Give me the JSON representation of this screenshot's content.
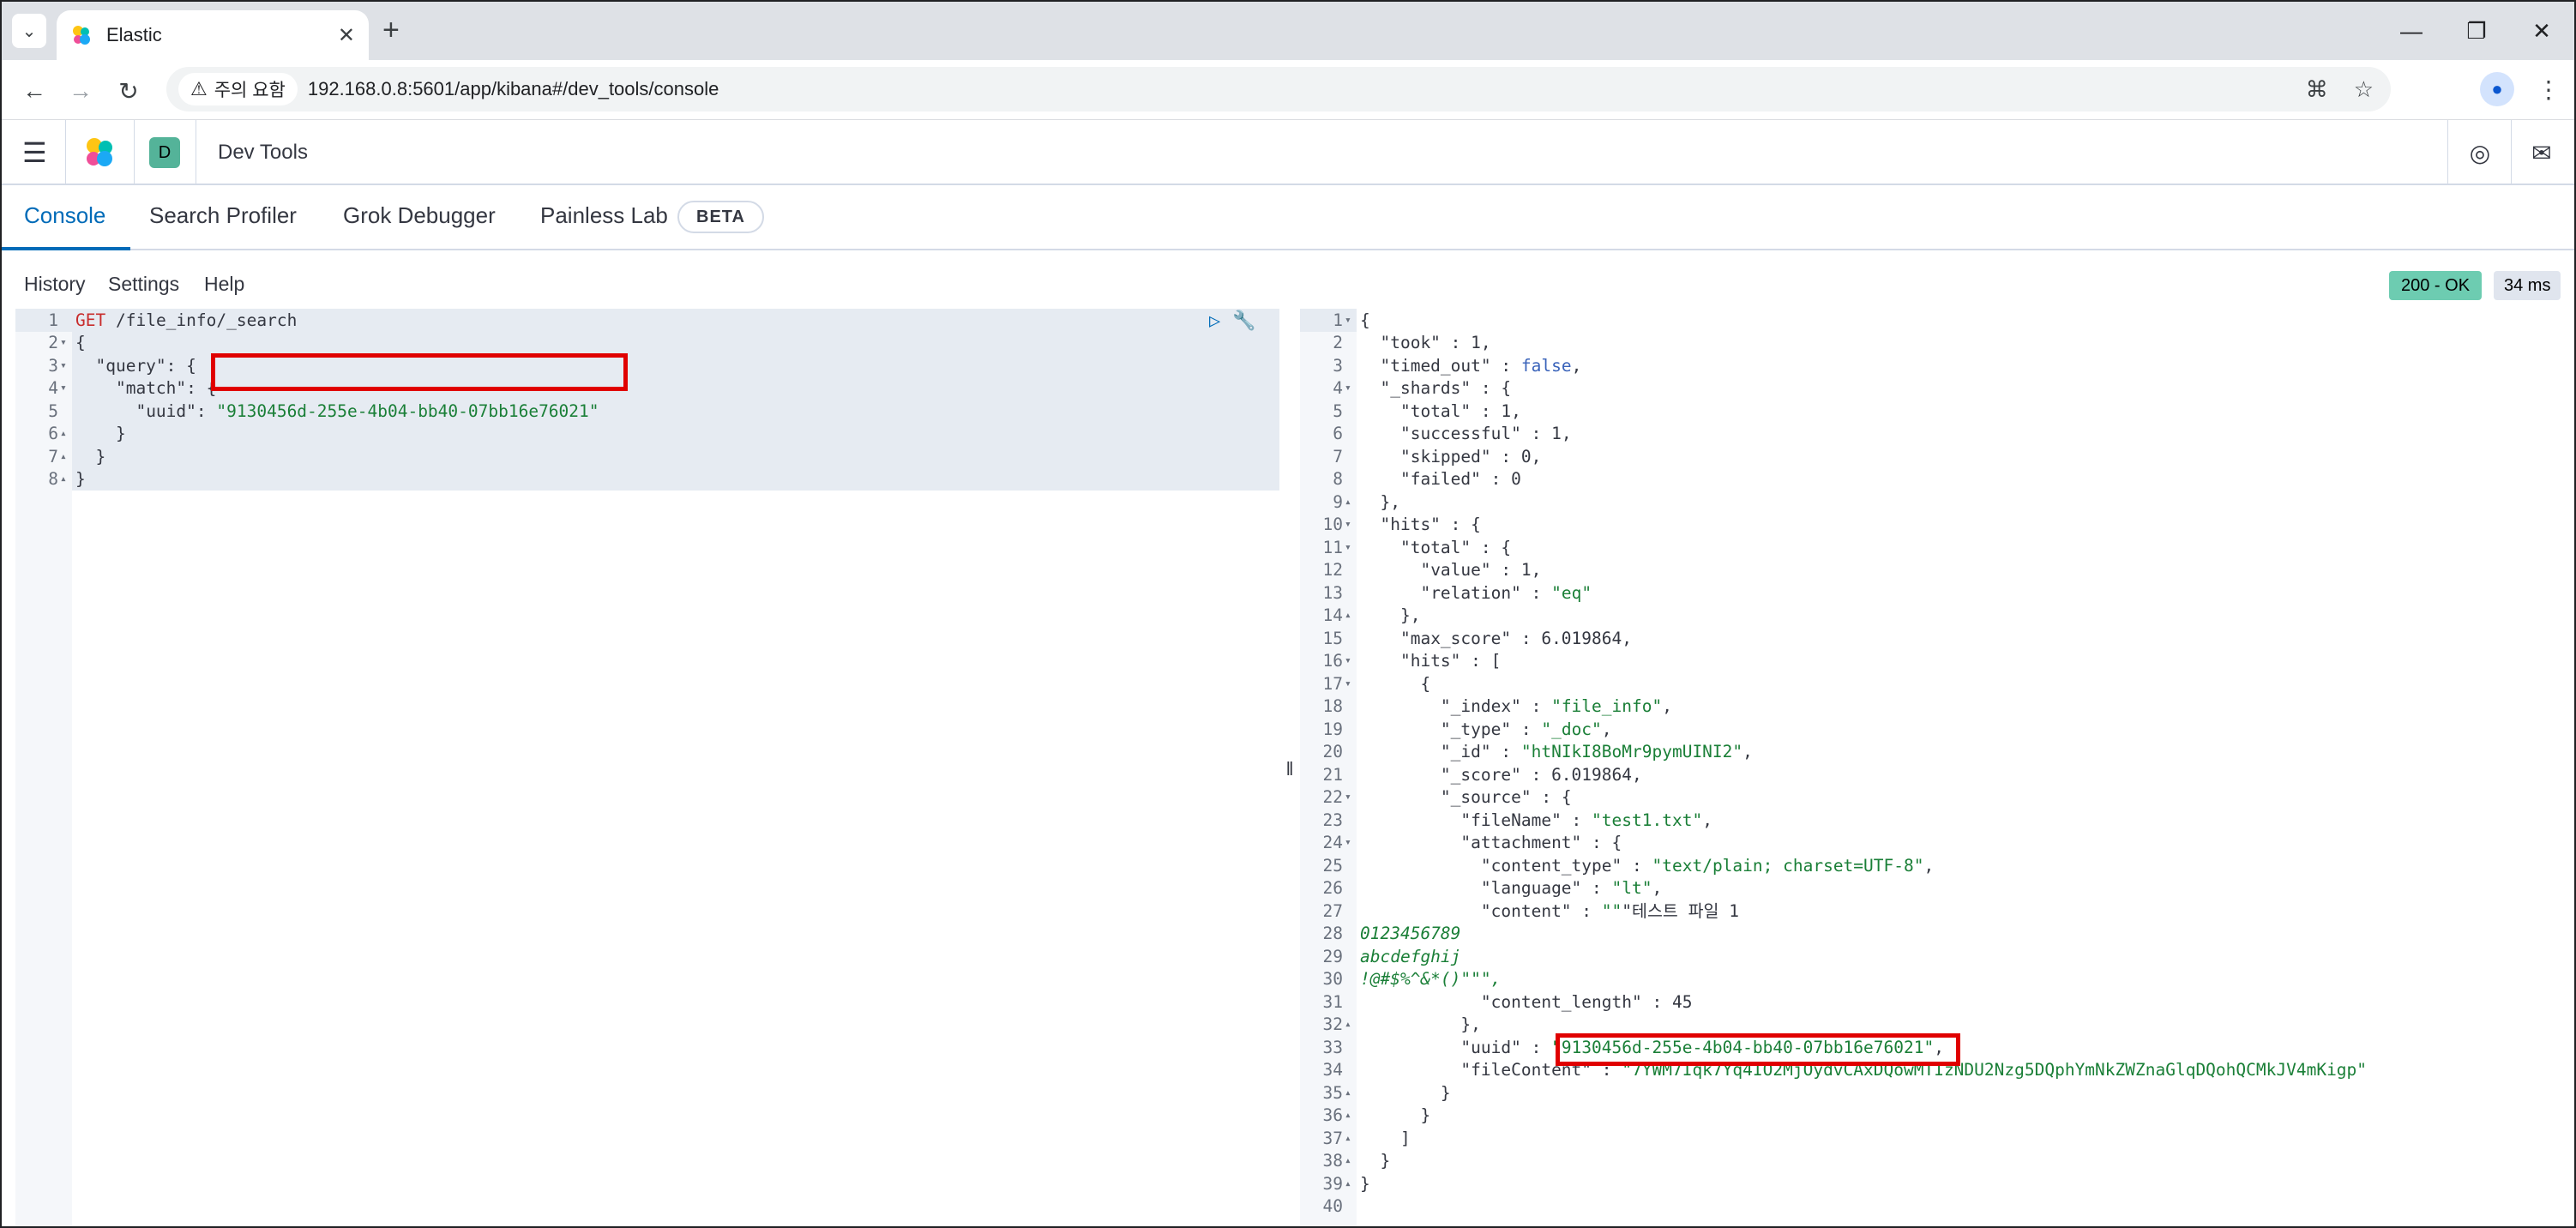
{
  "browser": {
    "tab_title": "Elastic",
    "warning_label": "주의 요함",
    "url": "192.168.0.8:5601/app/kibana#/dev_tools/console"
  },
  "kibana": {
    "space_initial": "D",
    "app_title": "Dev Tools"
  },
  "devtools_tabs": [
    {
      "label": "Console",
      "active": true
    },
    {
      "label": "Search Profiler",
      "active": false
    },
    {
      "label": "Grok Debugger",
      "active": false
    },
    {
      "label": "Painless Lab",
      "active": false
    }
  ],
  "beta_label": "BETA",
  "console_menu": {
    "history": "History",
    "settings": "Settings",
    "help": "Help"
  },
  "response_status": {
    "code": "200 - OK",
    "time": "34 ms"
  },
  "request_lines": [
    {
      "n": "1",
      "fold": "",
      "text": "GET /file_info/_search"
    },
    {
      "n": "2",
      "fold": "▾",
      "text": "{"
    },
    {
      "n": "3",
      "fold": "▾",
      "text": "  \"query\": {"
    },
    {
      "n": "4",
      "fold": "▾",
      "text": "    \"match\": {"
    },
    {
      "n": "5",
      "fold": "",
      "text": "      \"uuid\": \"9130456d-255e-4b04-bb40-07bb16e76021\""
    },
    {
      "n": "6",
      "fold": "▴",
      "text": "    }"
    },
    {
      "n": "7",
      "fold": "▴",
      "text": "  }"
    },
    {
      "n": "8",
      "fold": "▴",
      "text": "}"
    }
  ],
  "response_lines": [
    {
      "n": "1",
      "fold": "▾",
      "text": "{"
    },
    {
      "n": "2",
      "fold": "",
      "text": "  \"took\" : 1,"
    },
    {
      "n": "3",
      "fold": "",
      "text": "  \"timed_out\" : false,"
    },
    {
      "n": "4",
      "fold": "▾",
      "text": "  \"_shards\" : {"
    },
    {
      "n": "5",
      "fold": "",
      "text": "    \"total\" : 1,"
    },
    {
      "n": "6",
      "fold": "",
      "text": "    \"successful\" : 1,"
    },
    {
      "n": "7",
      "fold": "",
      "text": "    \"skipped\" : 0,"
    },
    {
      "n": "8",
      "fold": "",
      "text": "    \"failed\" : 0"
    },
    {
      "n": "9",
      "fold": "▴",
      "text": "  },"
    },
    {
      "n": "10",
      "fold": "▾",
      "text": "  \"hits\" : {"
    },
    {
      "n": "11",
      "fold": "▾",
      "text": "    \"total\" : {"
    },
    {
      "n": "12",
      "fold": "",
      "text": "      \"value\" : 1,"
    },
    {
      "n": "13",
      "fold": "",
      "text": "      \"relation\" : \"eq\""
    },
    {
      "n": "14",
      "fold": "▴",
      "text": "    },"
    },
    {
      "n": "15",
      "fold": "",
      "text": "    \"max_score\" : 6.019864,"
    },
    {
      "n": "16",
      "fold": "▾",
      "text": "    \"hits\" : ["
    },
    {
      "n": "17",
      "fold": "▾",
      "text": "      {"
    },
    {
      "n": "18",
      "fold": "",
      "text": "        \"_index\" : \"file_info\","
    },
    {
      "n": "19",
      "fold": "",
      "text": "        \"_type\" : \"_doc\","
    },
    {
      "n": "20",
      "fold": "",
      "text": "        \"_id\" : \"htNIkI8BoMr9pymUINI2\","
    },
    {
      "n": "21",
      "fold": "",
      "text": "        \"_score\" : 6.019864,"
    },
    {
      "n": "22",
      "fold": "▾",
      "text": "        \"_source\" : {"
    },
    {
      "n": "23",
      "fold": "",
      "text": "          \"fileName\" : \"test1.txt\","
    },
    {
      "n": "24",
      "fold": "▾",
      "text": "          \"attachment\" : {"
    },
    {
      "n": "25",
      "fold": "",
      "text": "            \"content_type\" : \"text/plain; charset=UTF-8\","
    },
    {
      "n": "26",
      "fold": "",
      "text": "            \"language\" : \"lt\","
    },
    {
      "n": "27",
      "fold": "",
      "text": "            \"content\" : \"\"\"테스트 파일 1"
    },
    {
      "n": "28",
      "fold": "",
      "text": "0123456789",
      "flush": true
    },
    {
      "n": "29",
      "fold": "",
      "text": "abcdefghij",
      "flush": true
    },
    {
      "n": "30",
      "fold": "",
      "text": "!@#$%^&*()\"\"\",",
      "flush": true
    },
    {
      "n": "31",
      "fold": "",
      "text": "            \"content_length\" : 45"
    },
    {
      "n": "32",
      "fold": "▴",
      "text": "          },"
    },
    {
      "n": "33",
      "fold": "",
      "text": "          \"uuid\" : \"9130456d-255e-4b04-bb40-07bb16e76021\","
    },
    {
      "n": "34",
      "fold": "",
      "text": "          \"fileContent\" : \"7YWM7Iqk7Yq4IO2MjOydvCAxDQowMTIzNDU2Nzg5DQphYmNkZWZnaGlqDQohQCMkJV4mKigp\""
    },
    {
      "n": "35",
      "fold": "▴",
      "text": "        }"
    },
    {
      "n": "36",
      "fold": "▴",
      "text": "      }"
    },
    {
      "n": "37",
      "fold": "▴",
      "text": "    ]"
    },
    {
      "n": "38",
      "fold": "▴",
      "text": "  }"
    },
    {
      "n": "39",
      "fold": "▴",
      "text": "}"
    },
    {
      "n": "40",
      "fold": "",
      "text": ""
    }
  ],
  "icons": {
    "tab_search": "chevron-down-icon",
    "new_tab": "plus-icon",
    "translate": "translate-icon",
    "bookmark": "star-icon",
    "help": "help-icon",
    "mail": "mail-icon",
    "run": "play-icon",
    "wrench": "wrench-icon"
  },
  "colors": {
    "accent": "#006bb8",
    "status_ok": "#6dccb1",
    "highlight_box": "#e00000",
    "string": "#1a7f37",
    "keyword": "#c82c2c"
  }
}
